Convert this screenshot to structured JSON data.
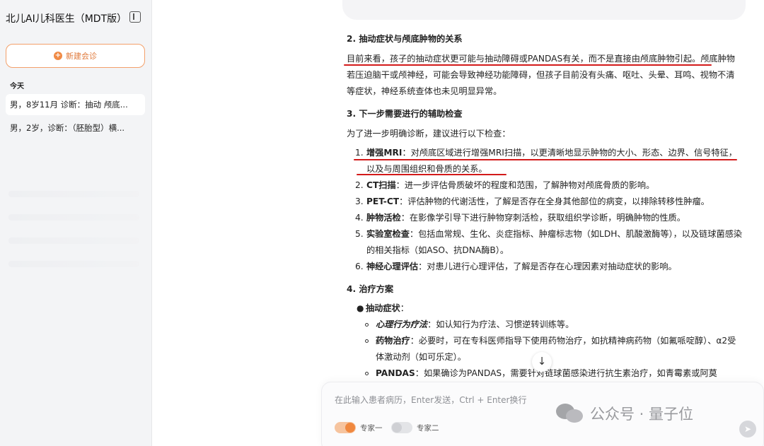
{
  "sidebar": {
    "app_title": "北儿AI儿科医生（MDT版）",
    "new_chat_label": "新建会诊",
    "section_today": "今天",
    "history": [
      {
        "label": "男，8岁11月 诊断：抽动 颅底..."
      },
      {
        "label": "男，2岁，诊断：（胚胎型）横..."
      }
    ]
  },
  "content": {
    "s2": {
      "heading": "2. 抽动症状与颅底肿物的关系",
      "p1_marked": "目前来看，孩子的抽动症状更可能与抽动障碍或PANDAS有关，而不是直接由颅底肿物引起。",
      "p1_rest": "颅底肿物若压迫脑干或颅神经，可能会导致神经功能障碍，但孩子目前没有头痛、呕吐、头晕、耳鸣、视物不清等症状，神经系统查体也未见明显异常。"
    },
    "s3": {
      "heading": "3. 下一步需要进行的辅助检查",
      "intro": "为了进一步明确诊断，建议进行以下检查：",
      "items": [
        {
          "num": "1.",
          "title": "增强MRI",
          "text": "：对颅底区域进行增强MRI扫描，以更清晰地显示肿物的大小、形态、边界、信号特征，以及与周围组织和骨质的关系。"
        },
        {
          "num": "2.",
          "title": "CT扫描",
          "text": "：进一步评估骨质破坏的程度和范围，了解肿物对颅底骨质的影响。"
        },
        {
          "num": "3.",
          "title": "PET-CT",
          "text": "：评估肿物的代谢活性，了解是否存在全身其他部位的病变，以排除转移性肿瘤。"
        },
        {
          "num": "4.",
          "title": "肿物活检",
          "text": "：在影像学引导下进行肿物穿刺活检，获取组织学诊断，明确肿物的性质。"
        },
        {
          "num": "5.",
          "title": "实验室检查",
          "text": "：包括血常规、生化、炎症指标、肿瘤标志物（如LDH、肌酸激酶等），以及链球菌感染的相关指标（如ASO、抗DNA酶B）。"
        },
        {
          "num": "6.",
          "title": "神经心理评估",
          "text": "：对患儿进行心理评估，了解是否存在心理因素对抽动症状的影响。"
        }
      ]
    },
    "s4": {
      "heading": "4. 治疗方案",
      "bullet_title": "抽动症状",
      "bullet_colon": "：",
      "subs": [
        {
          "title": "心理行为疗法",
          "text": "：如认知行为疗法、习惯逆转训练等。"
        },
        {
          "title": "药物治疗",
          "text": "：必要时，可在专科医师指导下使用药物治疗，如抗精神病药物（如氟哌啶醇）、α2受体激动剂（如可乐定）。"
        },
        {
          "title": "PANDAS",
          "text": "：如果确诊为PANDAS，需要针对链球菌感染进行抗生素治疗，如青霉素或阿莫"
        }
      ]
    }
  },
  "input": {
    "placeholder": "在此输入患者病历，Enter发送，Ctrl + Enter换行",
    "experts": [
      {
        "label": "专家一",
        "on": true
      },
      {
        "label": "专家二",
        "on": false
      }
    ]
  },
  "watermark": {
    "text": "公众号 · 量子位"
  },
  "colors": {
    "accent": "#f08a45",
    "annotation": "#d31a1a"
  },
  "icons": {
    "sidebar_toggle": "sidebar-toggle-icon",
    "new_chat": "plus-circle-icon",
    "scroll": "arrow-down-icon",
    "send": "send-icon",
    "watermark_logo": "wechat-icon"
  }
}
